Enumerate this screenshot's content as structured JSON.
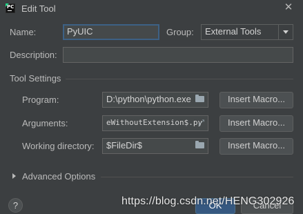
{
  "window": {
    "title": "Edit Tool",
    "app_icon": "pycharm-logo",
    "close_icon": "close-icon"
  },
  "form": {
    "name_label": "Name:",
    "name_value": "PyUIC",
    "group_label": "Group:",
    "group_value": "External Tools",
    "description_label": "Description:",
    "description_value": ""
  },
  "tool_settings": {
    "section_title": "Tool Settings",
    "program_label": "Program:",
    "program_value": "D:\\python\\python.exe",
    "arguments_label": "Arguments:",
    "arguments_value": "eWithoutExtension$.py",
    "working_dir_label": "Working directory:",
    "working_dir_value": "$FileDir$",
    "insert_macro_label": "Insert Macro..."
  },
  "advanced": {
    "label": "Advanced Options"
  },
  "footer": {
    "help_label": "?",
    "ok_label": "OK",
    "cancel_label": "Cancel"
  },
  "watermark": {
    "text": "https://blog.csdn.net/HENG302926"
  },
  "colors": {
    "background": "#3c3f41",
    "field_bg": "#45494a",
    "focus_border": "#3d6185",
    "primary_button": "#365880",
    "text": "#bbbbbb"
  }
}
